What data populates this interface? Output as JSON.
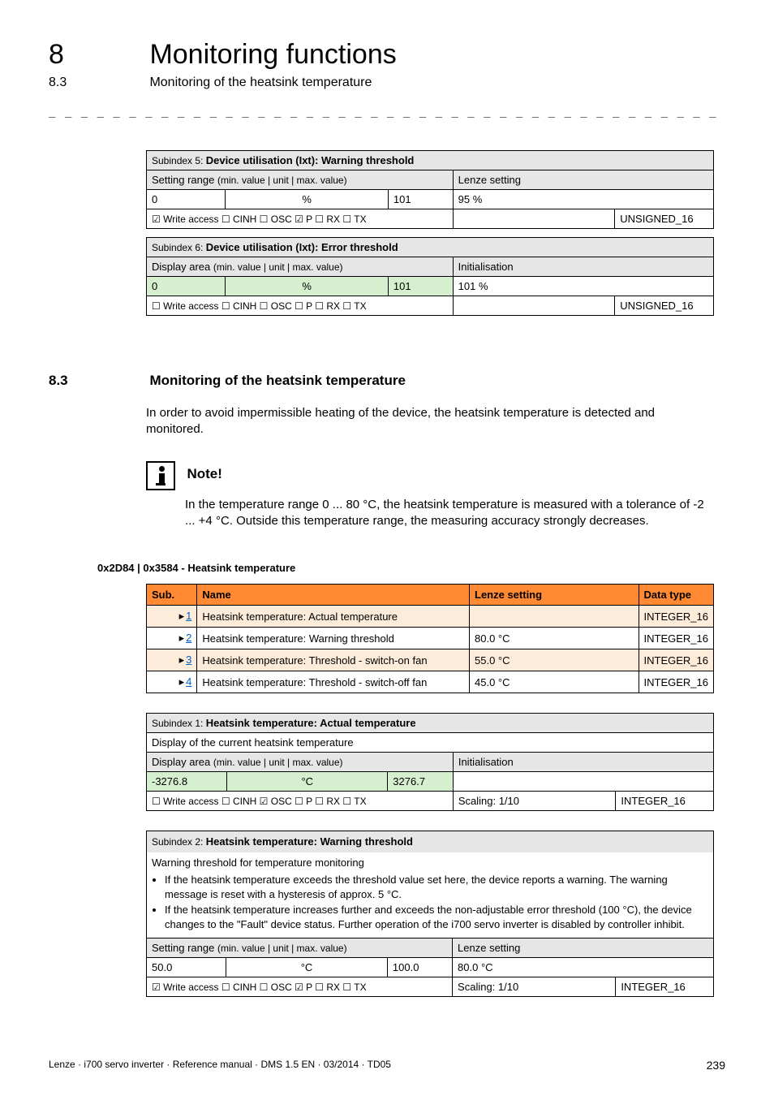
{
  "header": {
    "chapter_number": "8",
    "chapter_title": "Monitoring functions",
    "section_number": "8.3",
    "section_title": "Monitoring of the heatsink temperature",
    "dash_line": "_ _ _ _ _ _ _ _ _ _ _ _ _ _ _ _ _ _ _ _ _ _ _ _ _ _ _ _ _ _ _ _ _ _ _ _ _ _ _ _ _ _ _ _ _ _ _ _ _ _ _ _ _ _ _ _ _ _ _ _ _ _"
  },
  "table_sub5": {
    "title": "Subindex 5: Device utilisation (Ixt): Warning threshold",
    "range_label": "Setting range (min. value | unit | max. value)",
    "lenze_label": "Lenze setting",
    "min": "0",
    "unit": "%",
    "max": "101",
    "lenze_value": "95 %",
    "access": "☑ Write access   ☐ CINH   ☐ OSC   ☑ P   ☐ RX   ☐ TX",
    "datatype": "UNSIGNED_16"
  },
  "table_sub6": {
    "title": "Subindex 6: Device utilisation (Ixt): Error threshold",
    "range_label": "Display area (min. value | unit | max. value)",
    "init_label": "Initialisation",
    "min": "0",
    "unit": "%",
    "max": "101",
    "init_value": "101 %",
    "access": "☐ Write access   ☐ CINH   ☐ OSC   ☐ P   ☐ RX   ☐ TX",
    "datatype": "UNSIGNED_16"
  },
  "section": {
    "number": "8.3",
    "title": "Monitoring of the heatsink temperature",
    "para": "In order to avoid impermissible heating of the device, the heatsink temperature is detected and monitored."
  },
  "note": {
    "title": "Note!",
    "text": "In the temperature range 0 ... 80 °C, the heatsink temperature is measured with a tolerance of -2 ... +4 °C. Outside this temperature range, the measuring accuracy strongly decreases."
  },
  "object": {
    "heading": "0x2D84 | 0x3584 - Heatsink temperature",
    "cols": {
      "sub": "Sub.",
      "name": "Name",
      "lenze": "Lenze setting",
      "dtype": "Data type"
    },
    "rows": [
      {
        "sub": "1",
        "name": "Heatsink temperature: Actual temperature",
        "lenze": "",
        "dtype": "INTEGER_16"
      },
      {
        "sub": "2",
        "name": "Heatsink temperature: Warning threshold",
        "lenze": "80.0 °C",
        "dtype": "INTEGER_16"
      },
      {
        "sub": "3",
        "name": "Heatsink temperature: Threshold - switch-on fan",
        "lenze": "55.0 °C",
        "dtype": "INTEGER_16"
      },
      {
        "sub": "4",
        "name": "Heatsink temperature: Threshold - switch-off fan",
        "lenze": "45.0 °C",
        "dtype": "INTEGER_16"
      }
    ]
  },
  "sub1": {
    "title": "Subindex 1: Heatsink temperature: Actual temperature",
    "desc": "Display of the current heatsink temperature",
    "range_label": "Display area (min. value | unit | max. value)",
    "init_label": "Initialisation",
    "min": "-3276.8",
    "unit": "°C",
    "max": "3276.7",
    "init_value": "",
    "access": "☐ Write access   ☐ CINH   ☑ OSC   ☐ P   ☐ RX   ☐ TX",
    "scaling": "Scaling: 1/10",
    "datatype": "INTEGER_16"
  },
  "sub2": {
    "title": "Subindex 2: Heatsink temperature: Warning threshold",
    "desc_line1": "Warning threshold for temperature monitoring",
    "bullet1": "If the heatsink temperature exceeds the threshold value set here, the device reports a warning. The warning message is reset with a hysteresis of approx. 5 °C.",
    "bullet2": "If the heatsink temperature increases further and exceeds the non-adjustable error threshold (100 °C), the device changes to the \"Fault\" device status. Further operation of the i700 servo inverter is disabled by controller inhibit.",
    "range_label": "Setting range (min. value | unit | max. value)",
    "lenze_label": "Lenze setting",
    "min": "50.0",
    "unit": "°C",
    "max": "100.0",
    "lenze_value": "80.0 °C",
    "access": "☑ Write access   ☐ CINH   ☐ OSC   ☑ P   ☐ RX   ☐ TX",
    "scaling": "Scaling: 1/10",
    "datatype": "INTEGER_16"
  },
  "footer": {
    "text": "Lenze · i700 servo inverter · Reference manual · DMS 1.5 EN · 03/2014 · TD05",
    "page": "239"
  }
}
